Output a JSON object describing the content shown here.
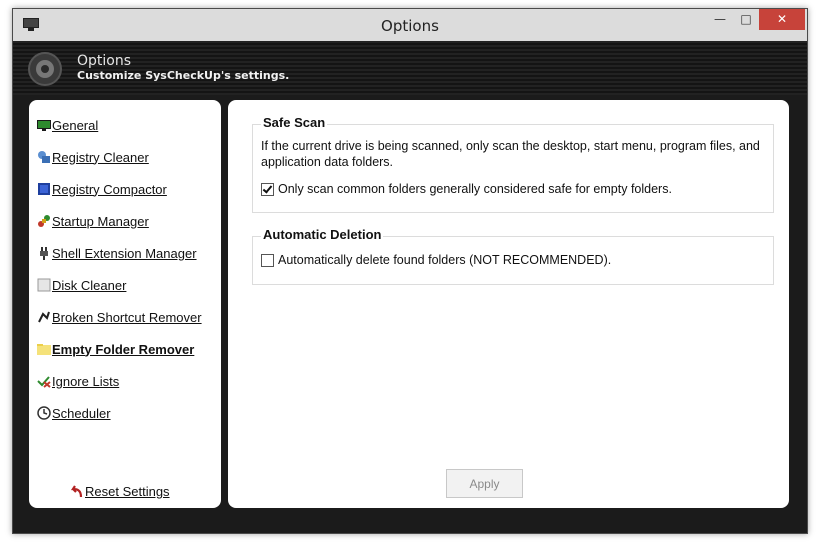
{
  "window": {
    "title": "Options"
  },
  "titlebar_buttons": {
    "minimize": "—",
    "maximize": "□",
    "close": "✕"
  },
  "header": {
    "title": "Options",
    "subtitle": "Customize SysCheckUp's settings."
  },
  "sidebar": {
    "items": [
      {
        "label": "General",
        "icon": "monitor-icon",
        "active": false
      },
      {
        "label": "Registry Cleaner",
        "icon": "registry-cleaner-icon",
        "active": false
      },
      {
        "label": "Registry Compactor",
        "icon": "registry-compactor-icon",
        "active": false
      },
      {
        "label": "Startup Manager",
        "icon": "startup-manager-icon",
        "active": false
      },
      {
        "label": "Shell Extension Manager",
        "icon": "plug-icon",
        "active": false
      },
      {
        "label": "Disk Cleaner",
        "icon": "disk-cleaner-icon",
        "active": false
      },
      {
        "label": "Broken Shortcut Remover",
        "icon": "broken-shortcut-icon",
        "active": false
      },
      {
        "label": "Empty Folder Remover",
        "icon": "folder-icon",
        "active": true
      },
      {
        "label": "Ignore Lists",
        "icon": "ignore-list-icon",
        "active": false
      },
      {
        "label": "Scheduler",
        "icon": "clock-icon",
        "active": false
      }
    ],
    "reset_label": "Reset Settings"
  },
  "safe_scan": {
    "title": "Safe Scan",
    "description": "If the current drive is being scanned, only scan the desktop, start menu, program files, and application data folders.",
    "option_label": "Only scan common folders generally considered safe for empty folders.",
    "option_checked": true
  },
  "auto_delete": {
    "title": "Automatic Deletion",
    "option_label": "Automatically delete found folders (NOT RECOMMENDED).",
    "option_checked": false
  },
  "apply_label": "Apply",
  "colors": {
    "close_button": "#c7433a",
    "header_bg": "#1b1b1b",
    "window_frame": "#1b1b1b"
  }
}
